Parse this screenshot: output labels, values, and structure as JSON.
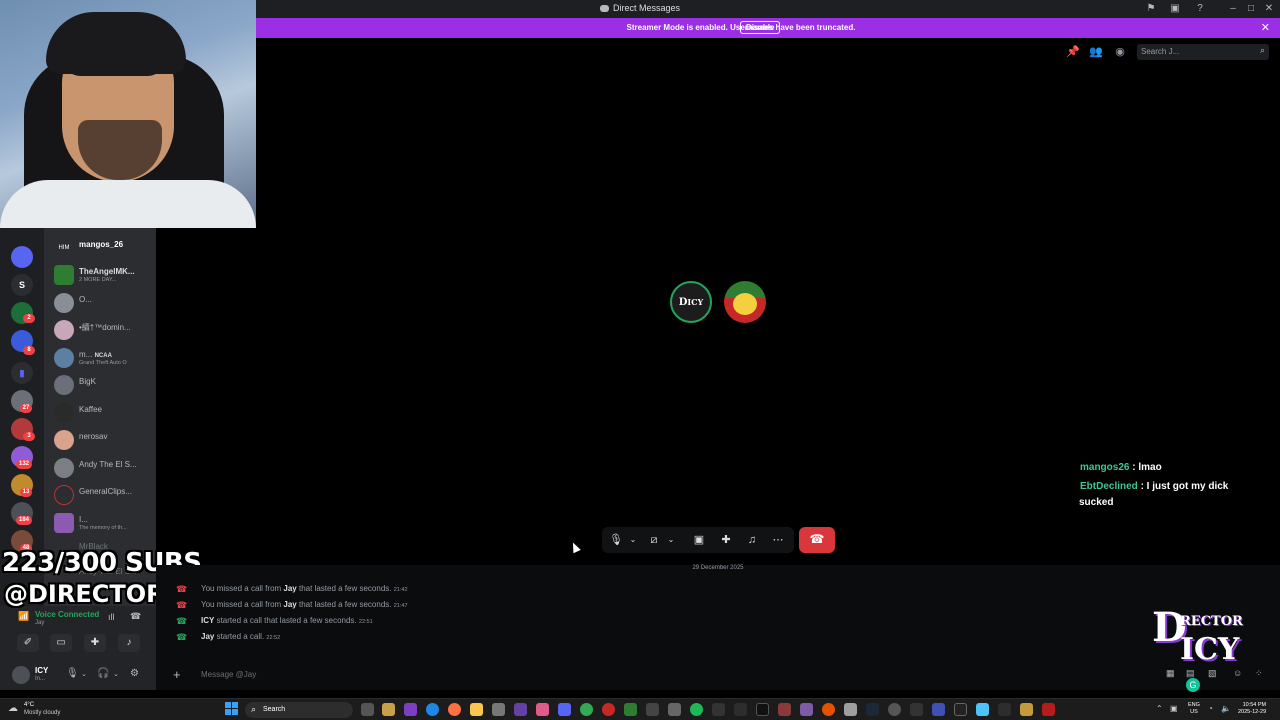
{
  "window": {
    "title": "Direct Messages",
    "controls": [
      "minimize",
      "maximize",
      "close"
    ]
  },
  "streamer_banner": {
    "message": "Streamer Mode is enabled. Usernames have been truncated.",
    "disable_label": "Disable",
    "color": "#9b2fe6"
  },
  "header": {
    "search_placeholder": "Search J..."
  },
  "servers": [
    {
      "label": "S"
    },
    {
      "badge": "2"
    },
    {
      "badge": "8"
    },
    {
      "badge": "27"
    },
    {
      "badge": "3"
    },
    {
      "badge": "132"
    },
    {
      "badge": "13"
    },
    {
      "badge": "184"
    },
    {
      "badge": "48"
    }
  ],
  "dms": [
    {
      "name": "mangos_26",
      "sub": "",
      "active": true
    },
    {
      "name": "TheAngelMK...",
      "sub": "2 MORE DAY...",
      "active": false
    },
    {
      "name": "O...",
      "sub": "",
      "active": false
    },
    {
      "name": "•續†™domin...",
      "sub": "",
      "active": false
    },
    {
      "name": "m...",
      "badge": "NCAA",
      "sub": "Grand Theft Auto O",
      "active": false
    },
    {
      "name": "BigK",
      "sub": "",
      "active": false
    },
    {
      "name": "Kaffee",
      "sub": "",
      "active": false
    },
    {
      "name": "nerosav",
      "sub": "",
      "active": false
    },
    {
      "name": "Andy The El S...",
      "sub": "",
      "active": false
    },
    {
      "name": "GeneralClips...",
      "sub": "",
      "active": false
    },
    {
      "name": "I...",
      "sub": "The memory of th...",
      "active": false
    },
    {
      "name": "MrBlack",
      "sub": "",
      "active": false
    },
    {
      "name": "Andy The El S...",
      "sub": "",
      "active": false
    }
  ],
  "overlay": {
    "subs": "223/300 SUBS",
    "handle": "@DIRECTORICY"
  },
  "voice": {
    "status": "Voice Connected",
    "channel": "Jay"
  },
  "user": {
    "name": "ICY",
    "status": "In..."
  },
  "call_controls": {
    "mute": "mic-icon",
    "video": "camera-off-icon",
    "screenshare": "screen-share-icon",
    "activities": "activities-icon",
    "soundboard": "soundboard-icon",
    "more": "⋯",
    "hangup": "phone-hangup-icon"
  },
  "chat_overlay": [
    {
      "user": "mangos26",
      "text": " : lmao"
    },
    {
      "user": "EbtDeclined",
      "text": " : I just got my dick",
      "continued": "sucked"
    }
  ],
  "messages": {
    "date": "29 December 2025",
    "items": [
      {
        "pre": "You missed a call from ",
        "bold": "Jay",
        "post": " that lasted a few seconds.",
        "time": "21:42",
        "missed": true
      },
      {
        "pre": "You missed a call from ",
        "bold": "Jay",
        "post": " that lasted a few seconds.",
        "time": "21:47",
        "missed": true
      },
      {
        "pre": "",
        "bold": "ICY",
        "post": " started a call that lasted a few seconds.",
        "time": "22:51",
        "missed": false
      },
      {
        "pre": "",
        "bold": "Jay",
        "post": " started a call.",
        "time": "22:52",
        "missed": false
      }
    ],
    "composer_placeholder": "Message @Jay"
  },
  "logo": {
    "line1": "D",
    "line2": "RECTOR",
    "line3": "ICY"
  },
  "taskbar": {
    "weather_temp": "4°C",
    "weather_desc": "Mostly cloudy",
    "search_placeholder": "Search",
    "lang1": "ENG",
    "lang2": "US",
    "time": "10:54 PM",
    "date": "2025-12-29"
  }
}
